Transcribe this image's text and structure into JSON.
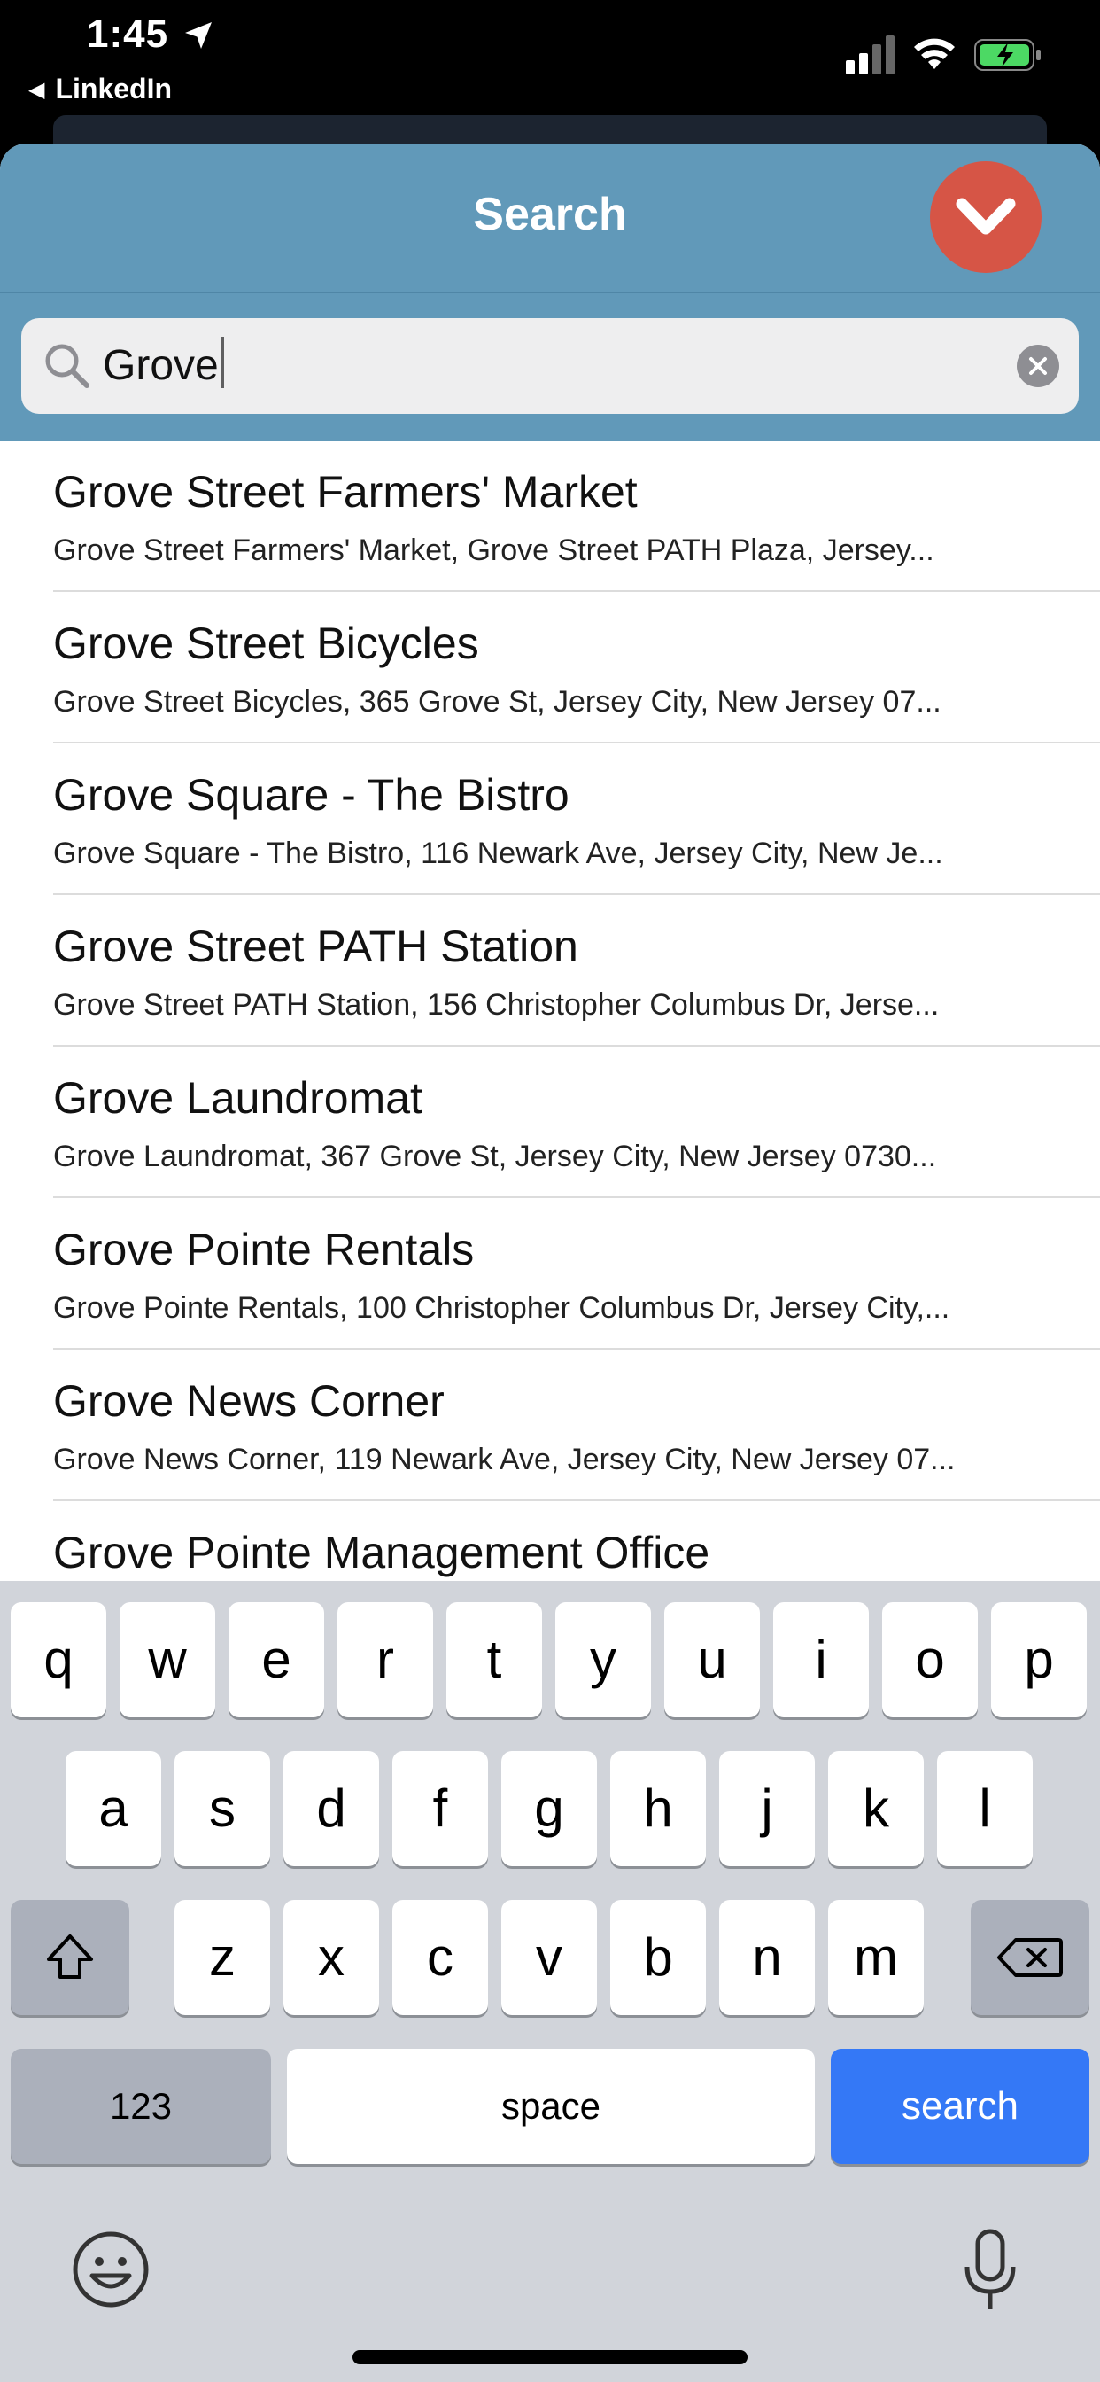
{
  "status_bar": {
    "time": "1:45",
    "back_app": "LinkedIn"
  },
  "header": {
    "title": "Search",
    "close_icon": "chevron-down-icon",
    "accent_color": "#6199b9",
    "close_color": "#d65546"
  },
  "search": {
    "value": "Grove",
    "icon": "search-icon",
    "clear_icon": "clear-icon"
  },
  "results": [
    {
      "title": "Grove Street Farmers' Market",
      "subtitle": "Grove Street Farmers' Market, Grove Street PATH Plaza, Jersey..."
    },
    {
      "title": "Grove Street Bicycles",
      "subtitle": "Grove Street Bicycles, 365 Grove St, Jersey City, New Jersey 07..."
    },
    {
      "title": "Grove Square - The Bistro",
      "subtitle": "Grove Square - The Bistro, 116 Newark Ave, Jersey City, New Je..."
    },
    {
      "title": "Grove Street PATH Station",
      "subtitle": "Grove Street PATH Station, 156 Christopher Columbus Dr, Jerse..."
    },
    {
      "title": "Grove Laundromat",
      "subtitle": "Grove Laundromat, 367 Grove St, Jersey City, New Jersey 0730..."
    },
    {
      "title": "Grove Pointe Rentals",
      "subtitle": "Grove Pointe Rentals, 100 Christopher Columbus Dr, Jersey City,..."
    },
    {
      "title": "Grove News Corner",
      "subtitle": "Grove News Corner, 119 Newark Ave, Jersey City, New Jersey 07..."
    },
    {
      "title": "Grove Pointe Management Office",
      "subtitle": ""
    }
  ],
  "keyboard": {
    "row1": [
      "q",
      "w",
      "e",
      "r",
      "t",
      "y",
      "u",
      "i",
      "o",
      "p"
    ],
    "row2": [
      "a",
      "s",
      "d",
      "f",
      "g",
      "h",
      "j",
      "k",
      "l"
    ],
    "row3": [
      "z",
      "x",
      "c",
      "v",
      "b",
      "n",
      "m"
    ],
    "numbers_key": "123",
    "space_key": "space",
    "search_key": "search",
    "search_key_color": "#3478f6"
  }
}
